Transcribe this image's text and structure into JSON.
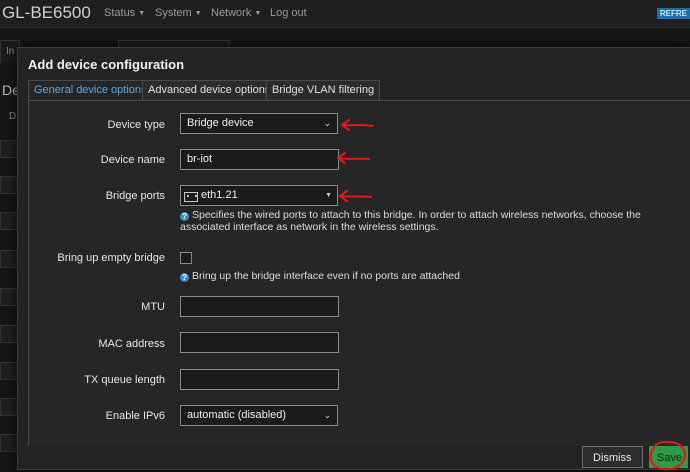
{
  "background": {
    "brand": "GL-BE6500",
    "menu": [
      {
        "label": "Status",
        "has_caret": true
      },
      {
        "label": "System",
        "has_caret": true
      },
      {
        "label": "Network",
        "has_caret": true
      },
      {
        "label": "Log out",
        "has_caret": false
      }
    ],
    "refresh_label": "REFRE",
    "tab_fragment": "In",
    "heading_fragment": "De",
    "row_fragment": "D"
  },
  "modal": {
    "title": "Add device configuration",
    "tabs": [
      {
        "label": "General device options",
        "active": true
      },
      {
        "label": "Advanced device options",
        "active": false
      },
      {
        "label": "Bridge VLAN filtering",
        "active": false
      }
    ],
    "fields": {
      "device_type": {
        "label": "Device type",
        "value": "Bridge device"
      },
      "device_name": {
        "label": "Device name",
        "value": "br-iot"
      },
      "bridge_ports": {
        "label": "Bridge ports",
        "value": "eth1.21",
        "help": "Specifies the wired ports to attach to this bridge. In order to attach wireless networks, choose the associated interface as network in the wireless settings."
      },
      "empty_bridge": {
        "label": "Bring up empty bridge",
        "checked": false,
        "help": "Bring up the bridge interface even if no ports are attached"
      },
      "mtu": {
        "label": "MTU",
        "value": ""
      },
      "mac_address": {
        "label": "MAC address",
        "value": ""
      },
      "tx_queue_length": {
        "label": "TX queue length",
        "value": ""
      },
      "enable_ipv6": {
        "label": "Enable IPv6",
        "value": "automatic (disabled)"
      }
    },
    "buttons": {
      "dismiss": "Dismiss",
      "save": "Save"
    }
  },
  "colors": {
    "accent_tab": "#5aa9e6",
    "save_button": "#2e9a46",
    "annotation": "#e01818"
  },
  "icons": [
    "chevron-down-icon",
    "ethernet-port-icon",
    "help-icon",
    "red-arrow-annotation",
    "red-circle-annotation"
  ]
}
